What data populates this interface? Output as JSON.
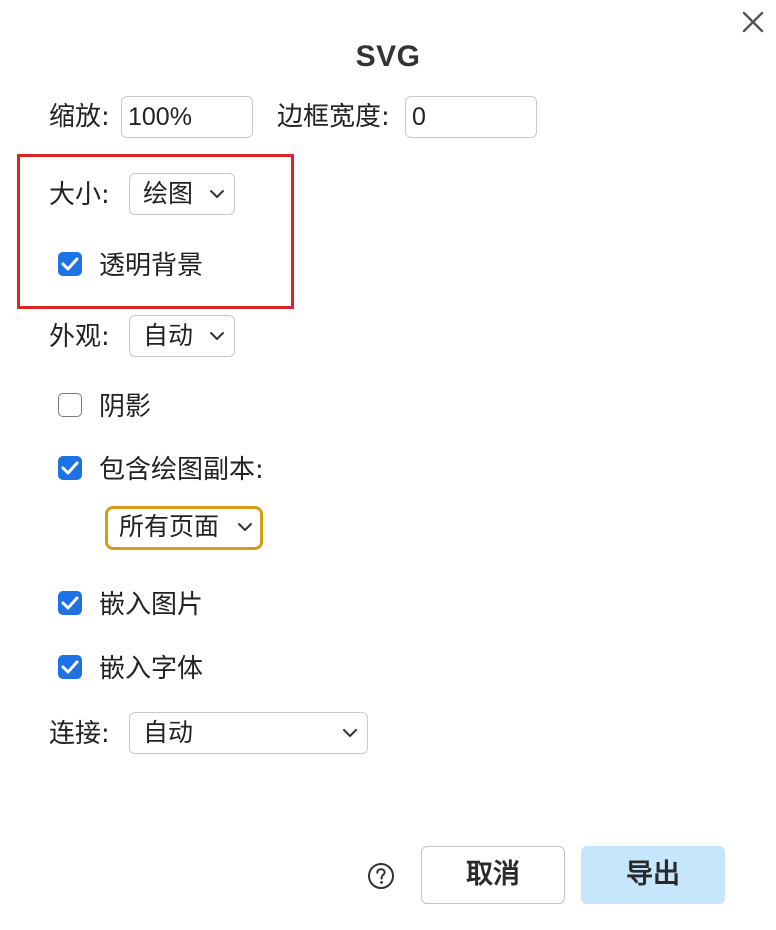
{
  "dialog": {
    "title": "SVG"
  },
  "zoom": {
    "label": "缩放:",
    "value": "100%"
  },
  "border_width": {
    "label": "边框宽度:",
    "value": "0"
  },
  "size": {
    "label": "大小:",
    "selected": "绘图"
  },
  "transparent_background": {
    "label": "透明背景",
    "checked": true
  },
  "appearance": {
    "label": "外观:",
    "selected": "自动"
  },
  "shadow": {
    "label": "阴影",
    "checked": false
  },
  "include_copy": {
    "label": "包含绘图副本:",
    "checked": true
  },
  "pages": {
    "selected": "所有页面"
  },
  "embed_images": {
    "label": "嵌入图片",
    "checked": true
  },
  "embed_fonts": {
    "label": "嵌入字体",
    "checked": true
  },
  "links": {
    "label": "连接:",
    "selected": "自动"
  },
  "footer": {
    "help_icon": "help-circle-icon",
    "cancel_label": "取消",
    "export_label": "导出"
  },
  "colors": {
    "checkbox_accent": "#1f72e5",
    "focus_ring": "#d69b17",
    "annotation_box": "#d9262b",
    "export_button_bg": "#c6e6fb"
  }
}
